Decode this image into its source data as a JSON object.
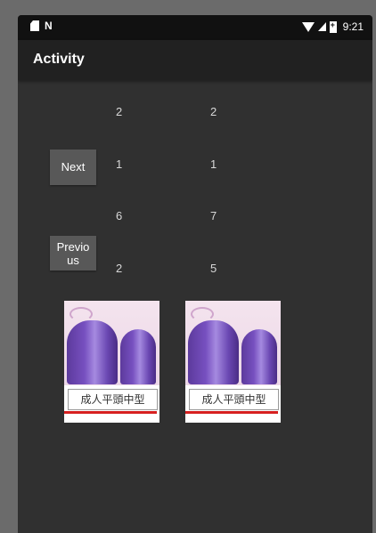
{
  "status_bar": {
    "time": "9:21"
  },
  "app_bar": {
    "title": "Activity"
  },
  "buttons": {
    "next": "Next",
    "previous": "Previo\nus"
  },
  "numbers": {
    "col1": [
      "2",
      "1",
      "6",
      "2"
    ],
    "col2": [
      "2",
      "1",
      "7",
      "5"
    ]
  },
  "images": [
    {
      "caption": "成人平頭中型"
    },
    {
      "caption": "成人平頭中型"
    }
  ]
}
